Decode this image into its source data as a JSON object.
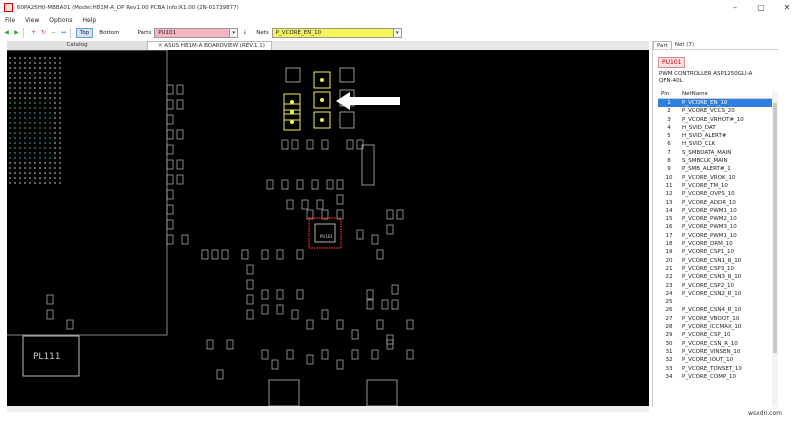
{
  "window": {
    "title": "60PA25H0-MBBA01 (Model:H81M-A_DP Rev1.00 PCBA Info:R1.00 (2N-01739877)",
    "controls": [
      "–",
      "▢",
      "✕"
    ]
  },
  "menu": [
    "File",
    "View",
    "Options",
    "Help"
  ],
  "toolbar": {
    "top_label": "Top",
    "bottom_label": "Bottom",
    "parts_label": "Parts",
    "parts_value": "PU101",
    "nets_label": "Nets",
    "nets_value": "P_VCORE_EN_10"
  },
  "tabs": {
    "catalog": "Catalog",
    "active": "ASUS H81M-A BOARDVIEW (REV.1.1)"
  },
  "board": {
    "labels": {
      "pl111": "PL111",
      "pu101": "PU101"
    },
    "colors": {
      "background": "#000000",
      "highlight": "#ff3333",
      "net": "#f0f050"
    }
  },
  "panel": {
    "tabs": [
      "Part",
      "Net (7)"
    ],
    "part_name": "PU101",
    "description": [
      "PWM CONTROLLER ASP1250GLI-A",
      "QFN-40L"
    ],
    "columns": [
      "Pin",
      "NetName"
    ],
    "pins": [
      {
        "pin": "1",
        "net": "P_VCORE_EN_10"
      },
      {
        "pin": "2",
        "net": "P_VCORE_VCCS_20"
      },
      {
        "pin": "3",
        "net": "P_VCORE_VRHOT#_10"
      },
      {
        "pin": "4",
        "net": "H_SVID_DAT"
      },
      {
        "pin": "5",
        "net": "H_SVID_ALERT#"
      },
      {
        "pin": "6",
        "net": "H_SVID_CLK"
      },
      {
        "pin": "7",
        "net": "S_SMBDATA_MAIN"
      },
      {
        "pin": "8",
        "net": "S_SMBCLK_MAIN"
      },
      {
        "pin": "9",
        "net": "P_SMB_ALERT#_1"
      },
      {
        "pin": "10",
        "net": "P_VCORE_VROK_10"
      },
      {
        "pin": "11",
        "net": "P_VCORE_TM_10"
      },
      {
        "pin": "12",
        "net": "P_VCORE_OVPS_10"
      },
      {
        "pin": "13",
        "net": "P_VCORE_ADDR_10"
      },
      {
        "pin": "14",
        "net": "P_VCORE_PWM1_10"
      },
      {
        "pin": "15",
        "net": "P_VCORE_PWM2_10"
      },
      {
        "pin": "16",
        "net": "P_VCORE_PWM3_10"
      },
      {
        "pin": "17",
        "net": "P_VCORE_PWM1_10"
      },
      {
        "pin": "18",
        "net": "P_VCORE_DRM_10"
      },
      {
        "pin": "19",
        "net": "P_VCORE_CSP1_10"
      },
      {
        "pin": "20",
        "net": "P_VCORE_CSN1_R_10"
      },
      {
        "pin": "21",
        "net": "P_VCORE_CSP3_10"
      },
      {
        "pin": "22",
        "net": "P_VCORE_CSN3_R_10"
      },
      {
        "pin": "23",
        "net": "P_VCORE_CSP2_10"
      },
      {
        "pin": "24",
        "net": "P_VCORE_CSN2_R_10"
      },
      {
        "pin": "25",
        "net": ""
      },
      {
        "pin": "26",
        "net": "P_VCORE_CSN4_R_10"
      },
      {
        "pin": "27",
        "net": "P_VCORE_VBOOT_10"
      },
      {
        "pin": "28",
        "net": "P_VCORE_ICCMAX_10"
      },
      {
        "pin": "29",
        "net": "P_VCORE_CSP_10"
      },
      {
        "pin": "30",
        "net": "P_VCORE_CSN_R_10"
      },
      {
        "pin": "31",
        "net": "P_VCORE_VINSEN_10"
      },
      {
        "pin": "32",
        "net": "P_VCORE_IOUT_10"
      },
      {
        "pin": "33",
        "net": "P_VCORE_TONSET_10"
      },
      {
        "pin": "34",
        "net": "P_VCORE_COMP_10"
      }
    ]
  },
  "watermark": "wsxdn.com"
}
